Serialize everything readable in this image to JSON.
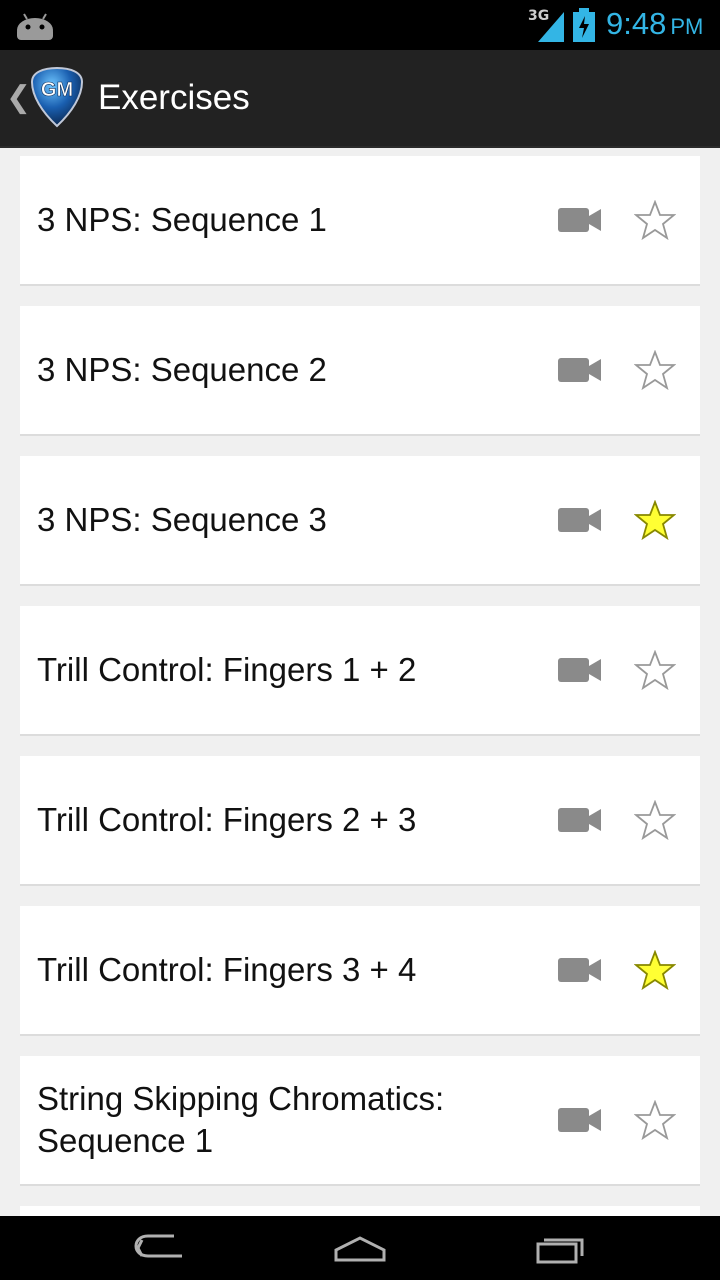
{
  "status_bar": {
    "network": "3G",
    "time": "9:48",
    "ampm": "PM",
    "accent_color": "#33b5e5"
  },
  "action_bar": {
    "title": "Exercises",
    "logo_text": "GM"
  },
  "exercises": [
    {
      "label": "3 NPS: Sequence 1",
      "favorite": false
    },
    {
      "label": "3 NPS: Sequence 2",
      "favorite": false
    },
    {
      "label": "3 NPS: Sequence 3",
      "favorite": true
    },
    {
      "label": "Trill Control: Fingers 1 + 2",
      "favorite": false
    },
    {
      "label": "Trill Control: Fingers 2 + 3",
      "favorite": false
    },
    {
      "label": "Trill Control: Fingers 3 + 4",
      "favorite": true
    },
    {
      "label": "String Skipping Chromatics: Sequence 1",
      "favorite": false
    }
  ],
  "colors": {
    "star_filled": "#ffff33",
    "star_outline": "#999999",
    "video_icon": "#8a8a8a"
  },
  "nav_bar": {
    "icons": [
      "back-icon",
      "home-icon",
      "recents-icon"
    ]
  }
}
